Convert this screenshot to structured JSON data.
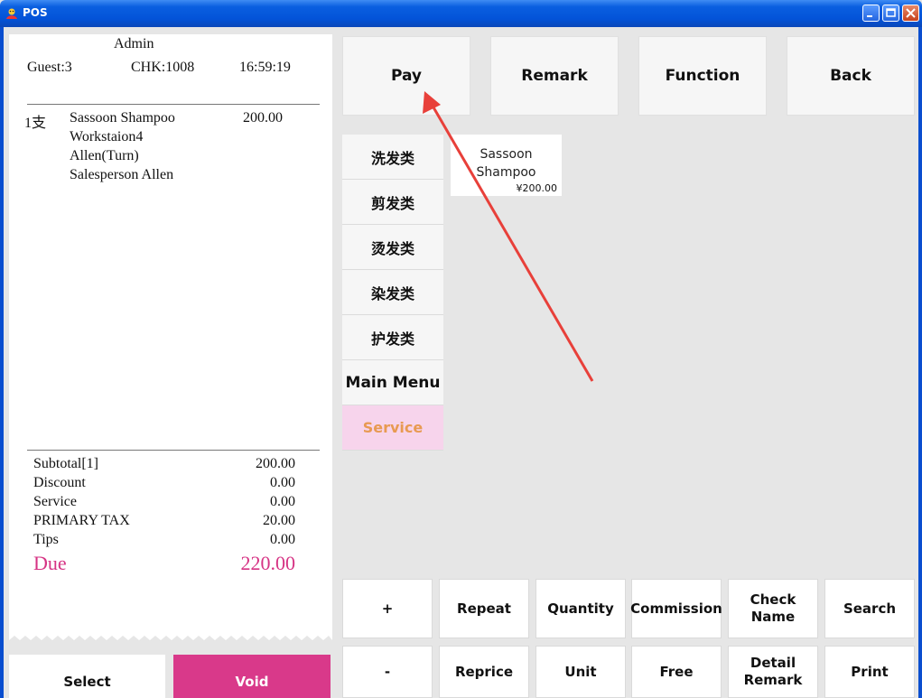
{
  "window": {
    "title": "POS"
  },
  "receipt": {
    "operator": "Admin",
    "guest": "Guest:3",
    "check": "CHK:1008",
    "time": "16:59:19",
    "item": {
      "qty": "1支",
      "name": "Sassoon Shampoo",
      "price": "200.00",
      "station": "Workstaion4",
      "staff": "Allen(Turn)",
      "salesperson": "Salesperson  Allen"
    },
    "totals": [
      {
        "label": "Subtotal[1]",
        "value": "200.00"
      },
      {
        "label": "Discount",
        "value": "0.00"
      },
      {
        "label": "Service",
        "value": "0.00"
      },
      {
        "label": "PRIMARY TAX",
        "value": "20.00"
      },
      {
        "label": "Tips",
        "value": "0.00"
      }
    ],
    "due_label": "Due",
    "due_value": "220.00"
  },
  "bottom_actions": {
    "select": "Select",
    "void": "Void"
  },
  "top_buttons": [
    "Pay",
    "Remark",
    "Function",
    "Back"
  ],
  "categories": [
    "洗发类",
    "剪发类",
    "烫发类",
    "染发类",
    "护发类",
    "Main Menu",
    "Service"
  ],
  "active_category": "Service",
  "product": {
    "name_line1": "Sassoon",
    "name_line2": "Shampoo",
    "price": "¥200.00"
  },
  "function_buttons": {
    "row1": [
      "+",
      "Repeat",
      "Quantity",
      "Commission",
      "Check Name",
      "Search"
    ],
    "row2": [
      "-",
      "Reprice",
      "Unit",
      "Free",
      "Detail Remark",
      "Print"
    ]
  },
  "colors": {
    "void": "#d9398a",
    "due": "#d63384",
    "active_category_bg": "#f7d4ec",
    "active_category_text": "#e89a52",
    "annotation_arrow": "#e8403a"
  }
}
